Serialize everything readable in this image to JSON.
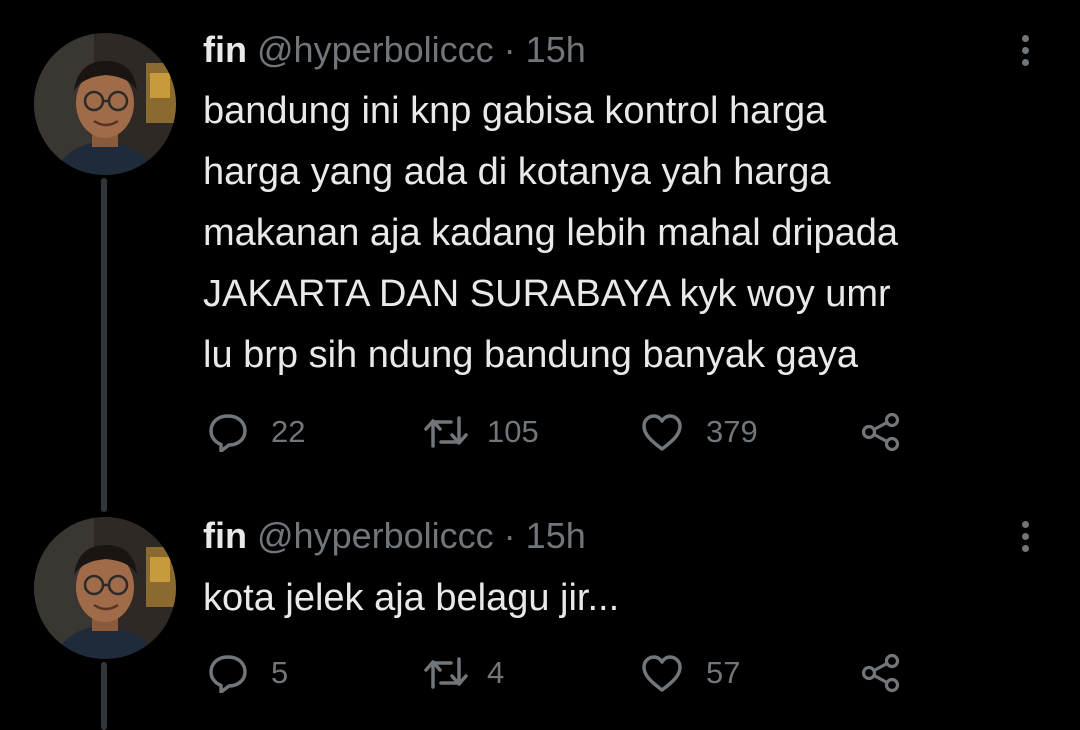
{
  "tweets": [
    {
      "display_name": "fin",
      "handle": "@hyperboliccc",
      "separator": "·",
      "time": "15h",
      "text": "bandung ini knp gabisa kontrol harga\nharga yang ada di kotanya yah harga\nmakanan aja kadang lebih mahal dripada\nJAKARTA DAN SURABAYA kyk woy umr\nlu brp sih ndung bandung banyak gaya",
      "replies": "22",
      "retweets": "105",
      "likes": "379"
    },
    {
      "display_name": "fin",
      "handle": "@hyperboliccc",
      "separator": "·",
      "time": "15h",
      "text": "kota jelek aja belagu jir...",
      "replies": "5",
      "retweets": "4",
      "likes": "57"
    }
  ],
  "icons": {
    "reply": "reply-icon",
    "retweet": "retweet-icon",
    "like": "heart-icon",
    "share": "share-icon",
    "more": "more-options-icon"
  },
  "colors": {
    "background": "#000000",
    "text": "#e7e9ea",
    "secondary": "#71767b",
    "thread_line": "#333639"
  }
}
